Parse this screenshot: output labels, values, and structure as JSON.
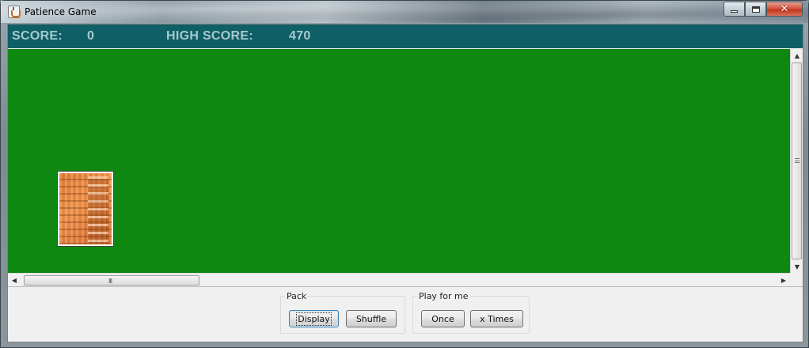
{
  "window": {
    "title": "Patience Game",
    "close_glyph": "✕"
  },
  "score_bar": {
    "score_label": "SCORE:",
    "score_value": "0",
    "high_score_label": "HIGH SCORE:",
    "high_score_value": "470",
    "background": "#0f5f67"
  },
  "table": {
    "background": "#0e8811",
    "card": {
      "face": "back"
    }
  },
  "scrollbars": {
    "up_arrow": "▲",
    "down_arrow": "▼",
    "left_arrow": "◀",
    "right_arrow": "▶",
    "h_grip": "III"
  },
  "controls": {
    "pack": {
      "label": "Pack",
      "display_button": "Display",
      "shuffle_button": "Shuffle"
    },
    "play_for_me": {
      "label": "Play for me",
      "once_button": "Once",
      "x_times_button": "x Times"
    }
  }
}
